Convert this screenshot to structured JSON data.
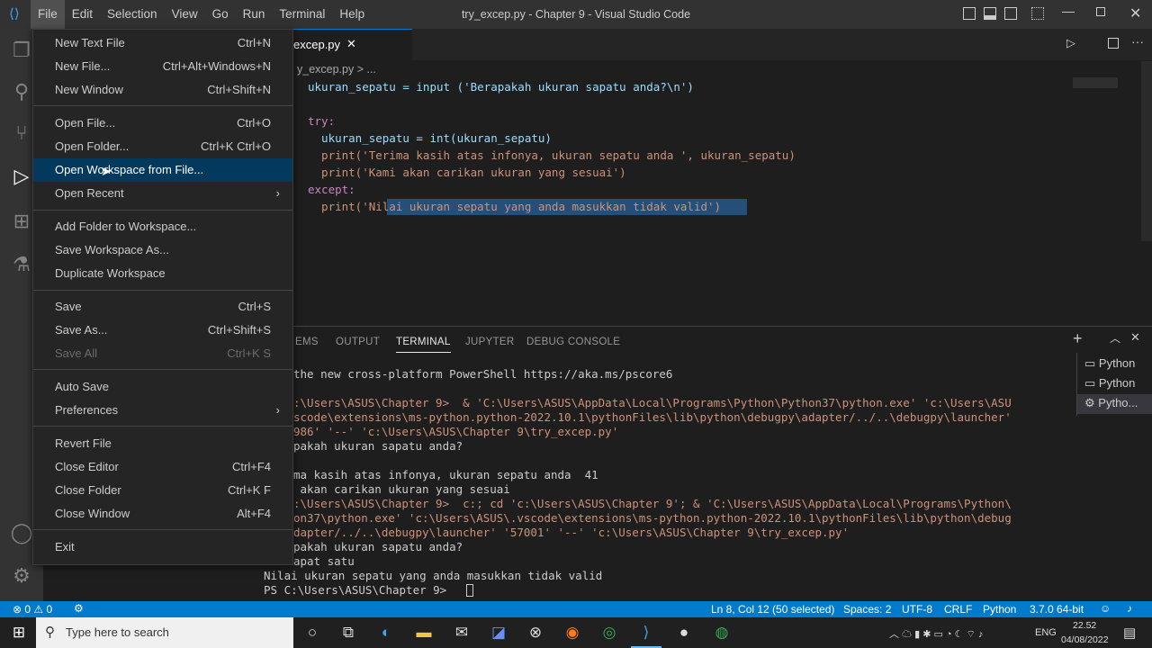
{
  "titlebar": {
    "menus": [
      "File",
      "Edit",
      "Selection",
      "View",
      "Go",
      "Run",
      "Terminal",
      "Help"
    ],
    "window_title": "try_excep.py - Chapter 9 - Visual Studio Code"
  },
  "tab": {
    "name": "excep.py",
    "breadcrumb": "y_excep.py > ..."
  },
  "code": [
    "ukuran_sepatu = input ('Berapakah ukuran sapatu anda?\\n')",
    "",
    "try:",
    "  ukuran_sepatu = int(ukuran_sepatu)",
    "  print('Terima kasih atas infonya, ukuran sepatu anda ', ukuran_sepatu)",
    "  print('Kami akan carikan ukuran yang sesuai')",
    "except:",
    "  print('Nilai ukuran sepatu yang anda masukkan tidak valid')"
  ],
  "panel": {
    "tabs": [
      "EMS",
      "OUTPUT",
      "TERMINAL",
      "JUPYTER",
      "DEBUG CONSOLE"
    ],
    "terminals": [
      "Python",
      "Python",
      "Pytho..."
    ],
    "lines": [
      "the new cross-platform PowerShell https://aka.ms/pscore6",
      "",
      ":\\Users\\ASUS\\Chapter 9>  & 'C:\\Users\\ASUS\\AppData\\Local\\Programs\\Python\\Python37\\python.exe' 'c:\\Users\\ASU",
      "scode\\extensions\\ms-python.python-2022.10.1\\pythonFiles\\lib\\python\\debugpy\\adapter/../..\\debugpy\\launcher'",
      "986' '--' 'c:\\Users\\ASUS\\Chapter 9\\try_excep.py'",
      "pakah ukuran sapatu anda?",
      "",
      "ma kasih atas infonya, ukuran sepatu anda  41",
      " akan carikan ukuran yang sesuai",
      ":\\Users\\ASUS\\Chapter 9>  c:; cd 'c:\\Users\\ASUS\\Chapter 9'; & 'C:\\Users\\ASUS\\AppData\\Local\\Programs\\Python\\",
      "on37\\python.exe' 'c:\\Users\\ASUS\\.vscode\\extensions\\ms-python.python-2022.10.1\\pythonFiles\\lib\\python\\debug",
      "dapter/../..\\debugpy\\launcher' '57001' '--' 'c:\\Users\\ASUS\\Chapter 9\\try_excep.py'",
      "pakah ukuran sapatu anda?",
      "apat satu",
      "Nilai ukuran sepatu yang anda masukkan tidak valid",
      "PS C:\\Users\\ASUS\\Chapter 9> "
    ]
  },
  "filemenu": [
    {
      "label": "New Text File",
      "key": "Ctrl+N"
    },
    {
      "label": "New File...",
      "key": "Ctrl+Alt+Windows+N"
    },
    {
      "label": "New Window",
      "key": "Ctrl+Shift+N"
    },
    {
      "label": "Open File...",
      "key": "Ctrl+O"
    },
    {
      "label": "Open Folder...",
      "key": "Ctrl+K Ctrl+O"
    },
    {
      "label": "Open Workspace from File...",
      "key": ""
    },
    {
      "label": "Open Recent",
      "key": "›"
    },
    {
      "label": "Add Folder to Workspace...",
      "key": ""
    },
    {
      "label": "Save Workspace As...",
      "key": ""
    },
    {
      "label": "Duplicate Workspace",
      "key": ""
    },
    {
      "label": "Save",
      "key": "Ctrl+S"
    },
    {
      "label": "Save As...",
      "key": "Ctrl+Shift+S"
    },
    {
      "label": "Save All",
      "key": "Ctrl+K S"
    },
    {
      "label": "Auto Save",
      "key": ""
    },
    {
      "label": "Preferences",
      "key": "›"
    },
    {
      "label": "Revert File",
      "key": ""
    },
    {
      "label": "Close Editor",
      "key": "Ctrl+F4"
    },
    {
      "label": "Close Folder",
      "key": "Ctrl+K F"
    },
    {
      "label": "Close Window",
      "key": "Alt+F4"
    },
    {
      "label": "Exit",
      "key": ""
    }
  ],
  "status": {
    "problems": "⊗ 0 ⚠ 0",
    "position": "Ln 8, Col 12 (50 selected)",
    "spaces": "Spaces: 2",
    "encoding": "UTF-8",
    "eol": "CRLF",
    "language": "Python",
    "interpreter": "3.7.0 64-bit"
  },
  "taskbar": {
    "search_placeholder": "Type here to search",
    "time": "22.52",
    "date": "04/08/2022",
    "lang": "ENG"
  }
}
